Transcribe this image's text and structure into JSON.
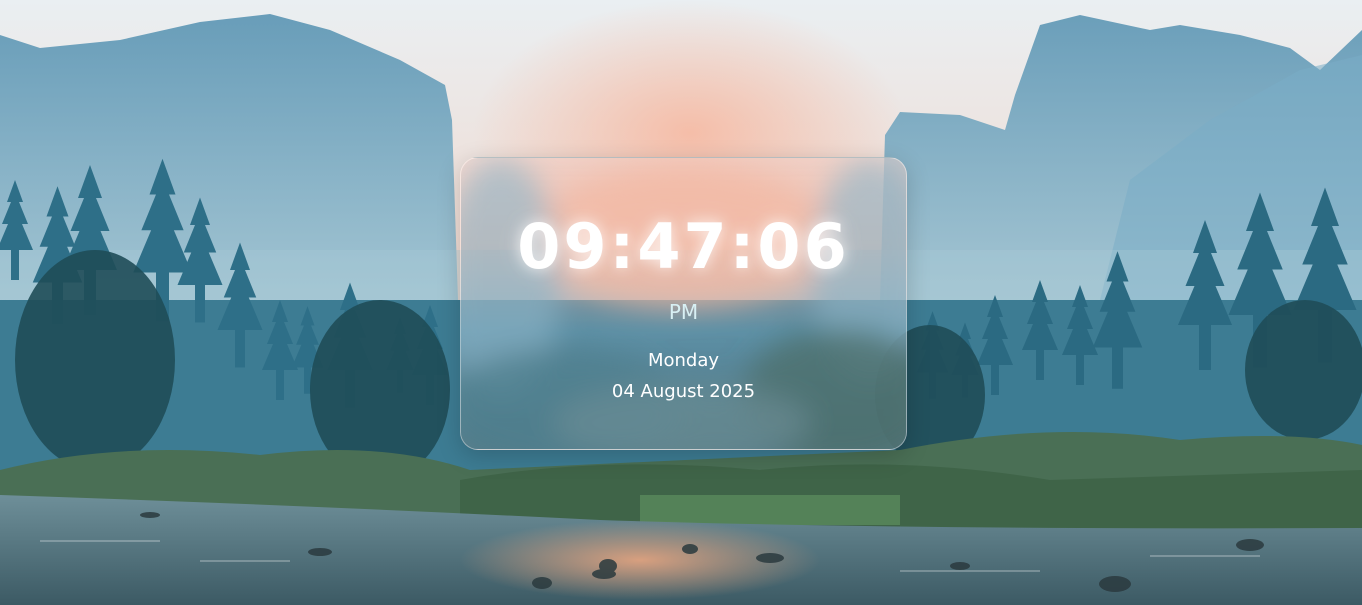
{
  "background": {
    "image": "mountain-river-forest-landscape"
  },
  "clock": {
    "time": "09:47:06",
    "period": "PM",
    "day": "Monday",
    "date": "04 August 2025"
  },
  "colors": {
    "sky_top": "#e8eef2",
    "sky_glow": "#f3c6b4",
    "mountain": "#6fa6c2",
    "forest": "#2f6f86",
    "water": "#4f6f7a",
    "text": "#ffffff"
  }
}
